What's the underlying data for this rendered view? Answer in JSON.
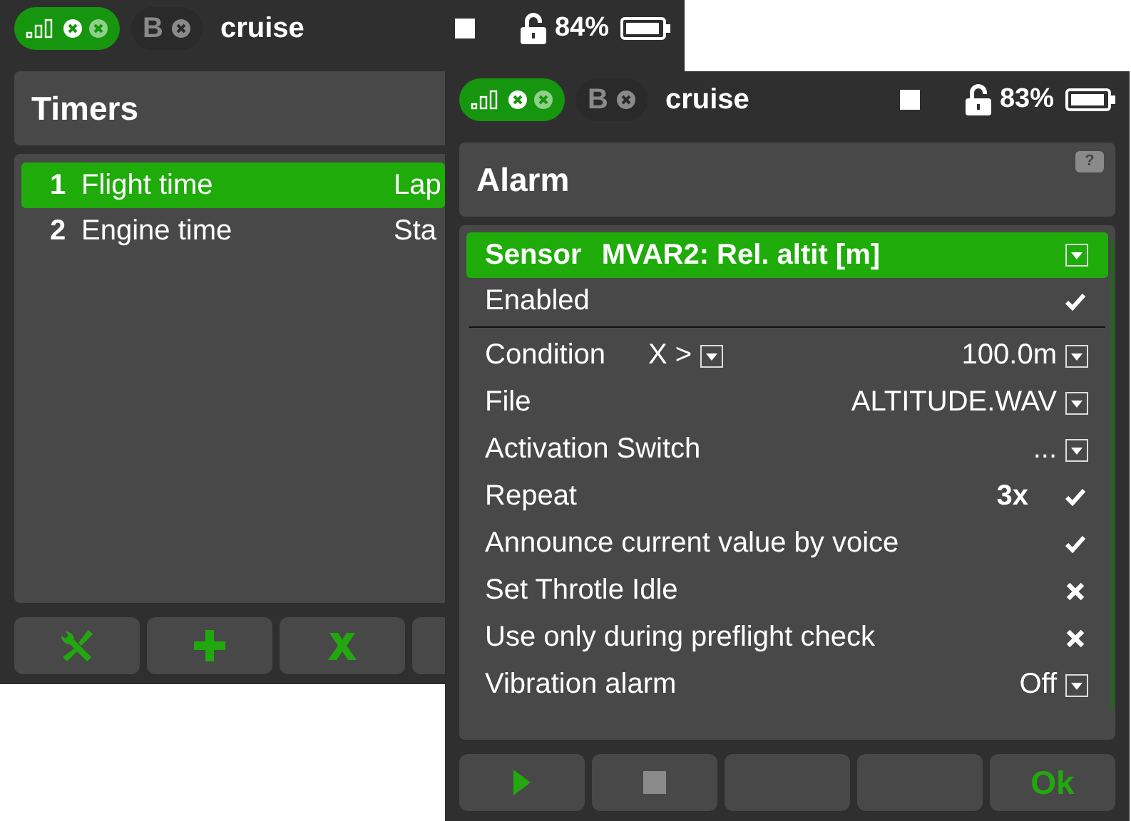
{
  "screens": [
    {
      "status_bar": {
        "model_slot": "B",
        "model_name": "cruise",
        "battery": "84%"
      },
      "title": "Timers",
      "timers": [
        {
          "number": "1",
          "name": "Flight time",
          "column_2": "Lap",
          "selected": true
        },
        {
          "number": "2",
          "name": "Engine time",
          "column_2": "Sta",
          "selected": false
        }
      ],
      "toolbar": [
        {
          "kind": "tools"
        },
        {
          "kind": "add"
        },
        {
          "kind": "delete"
        },
        {
          "kind": "blank"
        }
      ]
    },
    {
      "status_bar": {
        "model_slot": "B",
        "model_name": "cruise",
        "battery": "83%"
      },
      "title": "Alarm",
      "help": "?",
      "rows": [
        {
          "kind": "select",
          "label": "Sensor",
          "value": "MVAR2: Rel. altit [m]",
          "selected": true
        },
        {
          "kind": "toggle",
          "label": "Enabled",
          "checked": true,
          "selected": false
        },
        {
          "kind": "condition",
          "label": "Condition",
          "op": "X >",
          "value": "100.0m",
          "selected": false
        },
        {
          "kind": "select",
          "label": "File",
          "value": "ALTITUDE.WAV",
          "selected": false
        },
        {
          "kind": "select",
          "label": "Activation Switch",
          "value": "...",
          "selected": false
        },
        {
          "kind": "count",
          "label": "Repeat",
          "value": "3x",
          "checked": true,
          "selected": false
        },
        {
          "kind": "toggle",
          "label": "Announce current value by voice",
          "checked": true,
          "selected": false
        },
        {
          "kind": "toggle",
          "label": "Set Throtle Idle",
          "checked": false,
          "selected": false
        },
        {
          "kind": "toggle",
          "label": "Use only during preflight check",
          "checked": false,
          "selected": false
        },
        {
          "kind": "select",
          "label": "Vibration alarm",
          "value": "Off",
          "selected": false
        }
      ],
      "toolbar": [
        {
          "kind": "play"
        },
        {
          "kind": "stop"
        },
        {
          "kind": "blank"
        },
        {
          "kind": "blank"
        },
        {
          "kind": "text",
          "label": "Ok"
        }
      ]
    }
  ]
}
